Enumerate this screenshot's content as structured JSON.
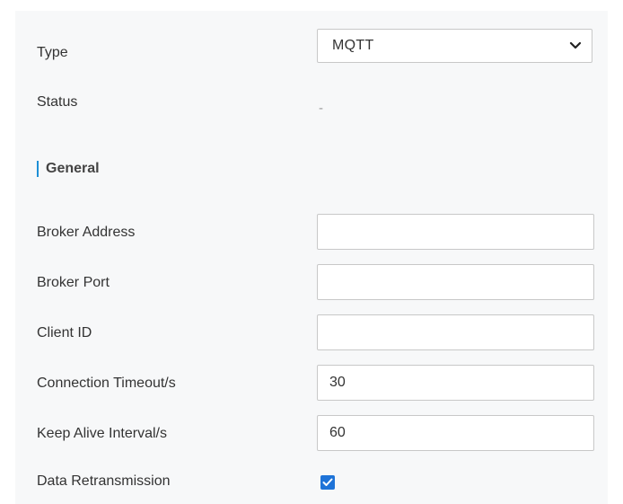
{
  "fields": {
    "type": {
      "label": "Type",
      "selected": "MQTT"
    },
    "status": {
      "label": "Status",
      "value": "-"
    }
  },
  "section": {
    "title": "General",
    "accent_color": "#1e8fd6"
  },
  "general": {
    "broker_address": {
      "label": "Broker Address",
      "value": ""
    },
    "broker_port": {
      "label": "Broker Port",
      "value": ""
    },
    "client_id": {
      "label": "Client ID",
      "value": ""
    },
    "connection_timeout": {
      "label": "Connection Timeout/s",
      "value": "30"
    },
    "keep_alive_interval": {
      "label": "Keep Alive Interval/s",
      "value": "60"
    },
    "data_retransmission": {
      "label": "Data Retransmission",
      "checked": true
    }
  },
  "icons": {
    "dropdown": "chevron-down-icon",
    "checkbox": "checkmark-icon"
  },
  "colors": {
    "checkbox": "#1e73d8",
    "panel_background": "#f7f8f9"
  }
}
